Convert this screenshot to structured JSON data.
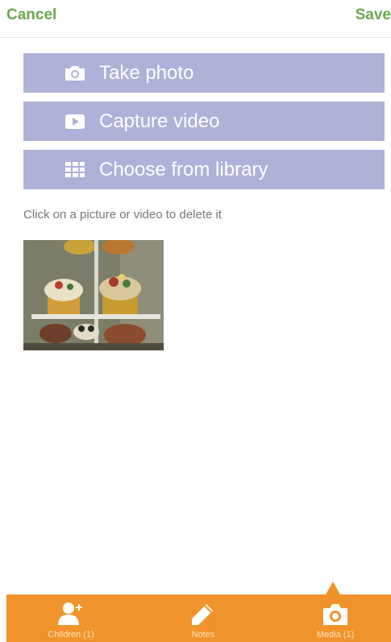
{
  "header": {
    "cancel_label": "Cancel",
    "save_label": "Save"
  },
  "actions": [
    {
      "label": "Take photo",
      "icon": "camera-icon"
    },
    {
      "label": "Capture video",
      "icon": "video-play-icon"
    },
    {
      "label": "Choose from library",
      "icon": "grid-icon"
    }
  ],
  "hint": "Click on a picture or video to delete it",
  "media": [
    {
      "type": "photo",
      "description_icon": "photo-thumbnail"
    }
  ],
  "tabbar": {
    "tabs": [
      {
        "label": "Children (1)",
        "icon": "add-person-icon"
      },
      {
        "label": "Notes",
        "icon": "pencil-icon"
      },
      {
        "label": "Media (1)",
        "icon": "camera-icon",
        "active": true
      }
    ]
  },
  "colors": {
    "accent_green": "#6aa84f",
    "button_bg": "#aeb2d9",
    "tabbar_bg": "#f0932a"
  }
}
